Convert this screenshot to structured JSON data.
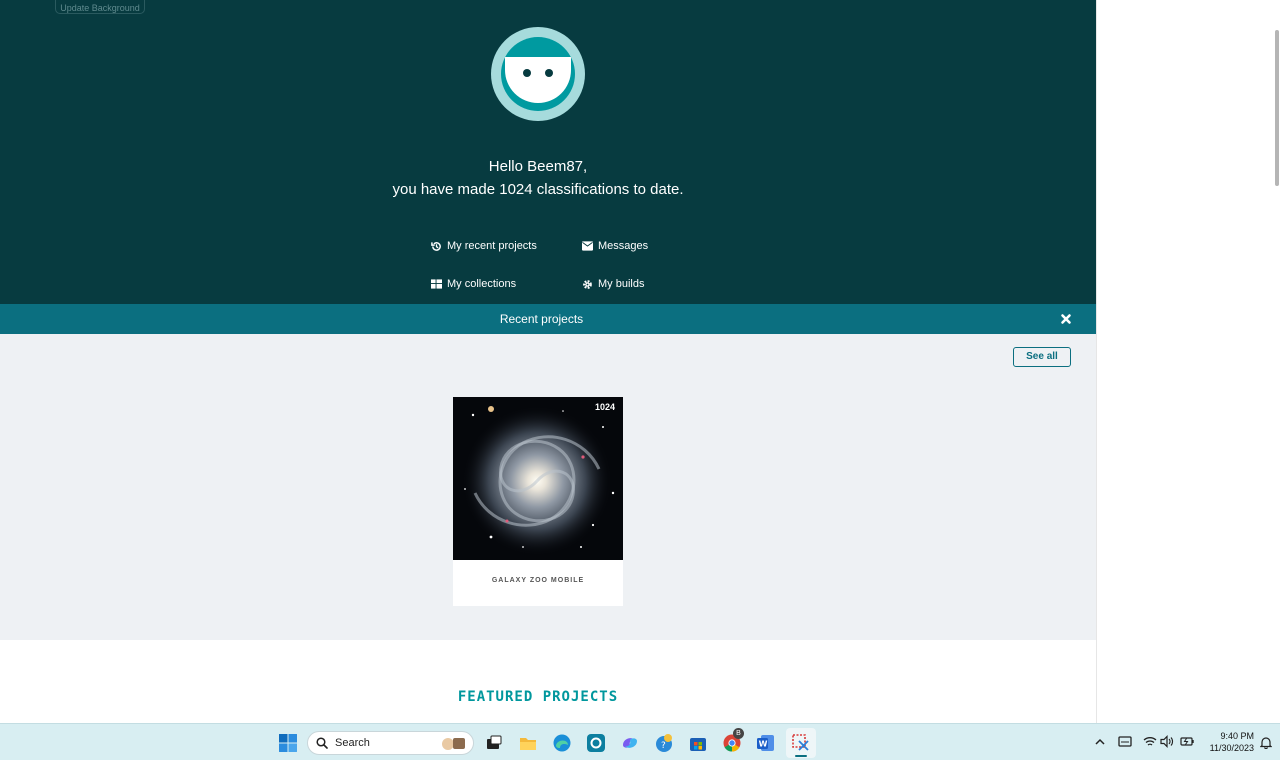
{
  "hero": {
    "background_button_label": "Update Background",
    "greeting_line1": "Hello Beem87,",
    "greeting_line2": "you have made 1024 classifications to date.",
    "links": {
      "recent_projects": "My recent projects",
      "messages": "Messages",
      "collections": "My collections",
      "builds": "My builds"
    }
  },
  "recent": {
    "title": "Recent projects",
    "see_all": "See all",
    "project": {
      "name": "GALAXY ZOO MOBILE",
      "count": "1024"
    }
  },
  "featured": {
    "title": "FEATURED PROJECTS"
  },
  "taskbar": {
    "search_placeholder": "Search",
    "time": "9:40 PM",
    "date": "11/30/2023",
    "chrome_badge": "B"
  },
  "colors": {
    "hero_bg": "#073b40",
    "bar_bg": "#0b6f80",
    "accent": "#00979d",
    "avatar_ring": "#a6dbdc",
    "recent_bg": "#eef1f4"
  }
}
